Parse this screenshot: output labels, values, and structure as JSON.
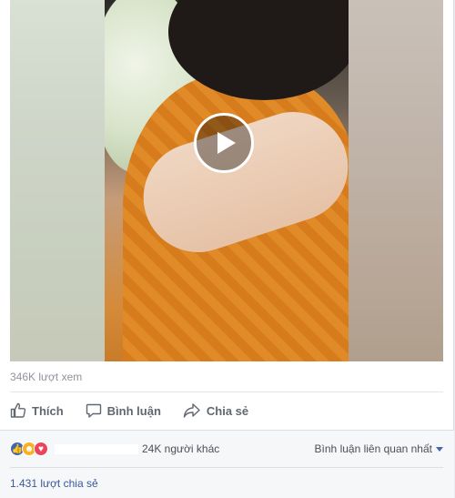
{
  "video": {
    "play_icon": "play-icon"
  },
  "stats": {
    "views_text": "346K lượt xem"
  },
  "actions": {
    "like_label": "Thích",
    "comment_label": "Bình luận",
    "share_label": "Chia sẻ"
  },
  "reactions": {
    "icons": [
      "like-icon",
      "haha-icon",
      "love-icon"
    ],
    "others_text": "24K người khác"
  },
  "comments_sort": {
    "label": "Bình luận liên quan nhất"
  },
  "shares": {
    "text": "1.431 lượt chia sẻ"
  },
  "colors": {
    "accent": "#4267b2",
    "link": "#385898",
    "action_text": "#606770"
  }
}
